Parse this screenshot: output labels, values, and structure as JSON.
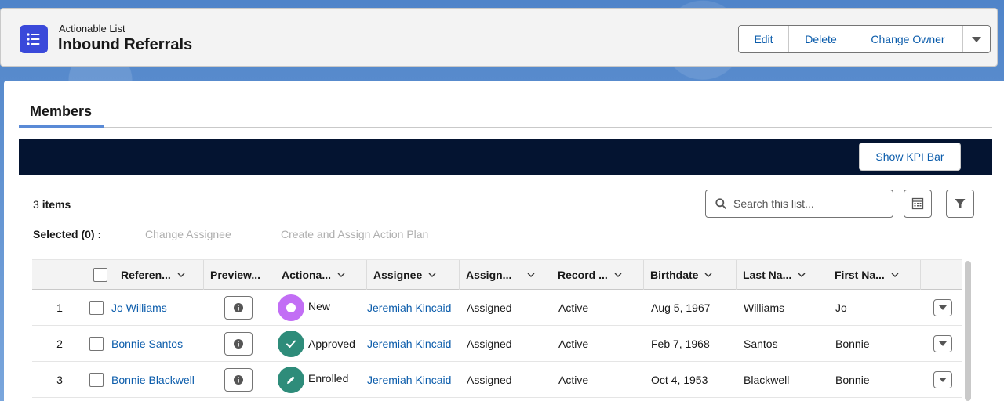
{
  "header": {
    "object_type": "Actionable List",
    "title": "Inbound Referrals",
    "buttons": {
      "edit": "Edit",
      "delete": "Delete",
      "change_owner": "Change Owner"
    }
  },
  "tabs": {
    "members": "Members"
  },
  "kpi": {
    "button": "Show KPI Bar"
  },
  "list": {
    "count": "3",
    "count_suffix": "items",
    "selected": "Selected (0) :",
    "actions": [
      "Change Assignee",
      "Create and Assign Action Plan"
    ],
    "search_placeholder": "Search this list..."
  },
  "table": {
    "headers": [
      "Referen...",
      "Preview...",
      "Actiona...",
      "Assignee",
      "Assign...",
      "Record ...",
      "Birthdate",
      "Last Na...",
      "First Na..."
    ],
    "rows": [
      {
        "num": "1",
        "reference": "Jo Williams",
        "status": "New",
        "assignee": "Jeremiah Kincaid",
        "assign": "Assigned",
        "record": "Active",
        "birthdate": "Aug 5, 1967",
        "last": "Williams",
        "first": "Jo"
      },
      {
        "num": "2",
        "reference": "Bonnie Santos",
        "status": "Approved",
        "assignee": "Jeremiah Kincaid",
        "assign": "Assigned",
        "record": "Active",
        "birthdate": "Feb 7, 1968",
        "last": "Santos",
        "first": "Bonnie"
      },
      {
        "num": "3",
        "reference": "Bonnie Blackwell",
        "status": "Enrolled",
        "assignee": "Jeremiah Kincaid",
        "assign": "Assigned",
        "record": "Active",
        "birthdate": "Oct 4, 1953",
        "last": "Blackwell",
        "first": "Bonnie"
      }
    ]
  },
  "colors": {
    "accent": "#0b5cab",
    "icon_blue": "#3a49da",
    "kpi_bar": "#041431",
    "status_new": "#c26ef5",
    "status_approved": "#2e8c7a",
    "status_enrolled": "#2e8c7a"
  },
  "icons": {
    "object": "list-icon",
    "new": "circle-icon",
    "approved": "check-icon",
    "enrolled": "pencil-icon"
  }
}
